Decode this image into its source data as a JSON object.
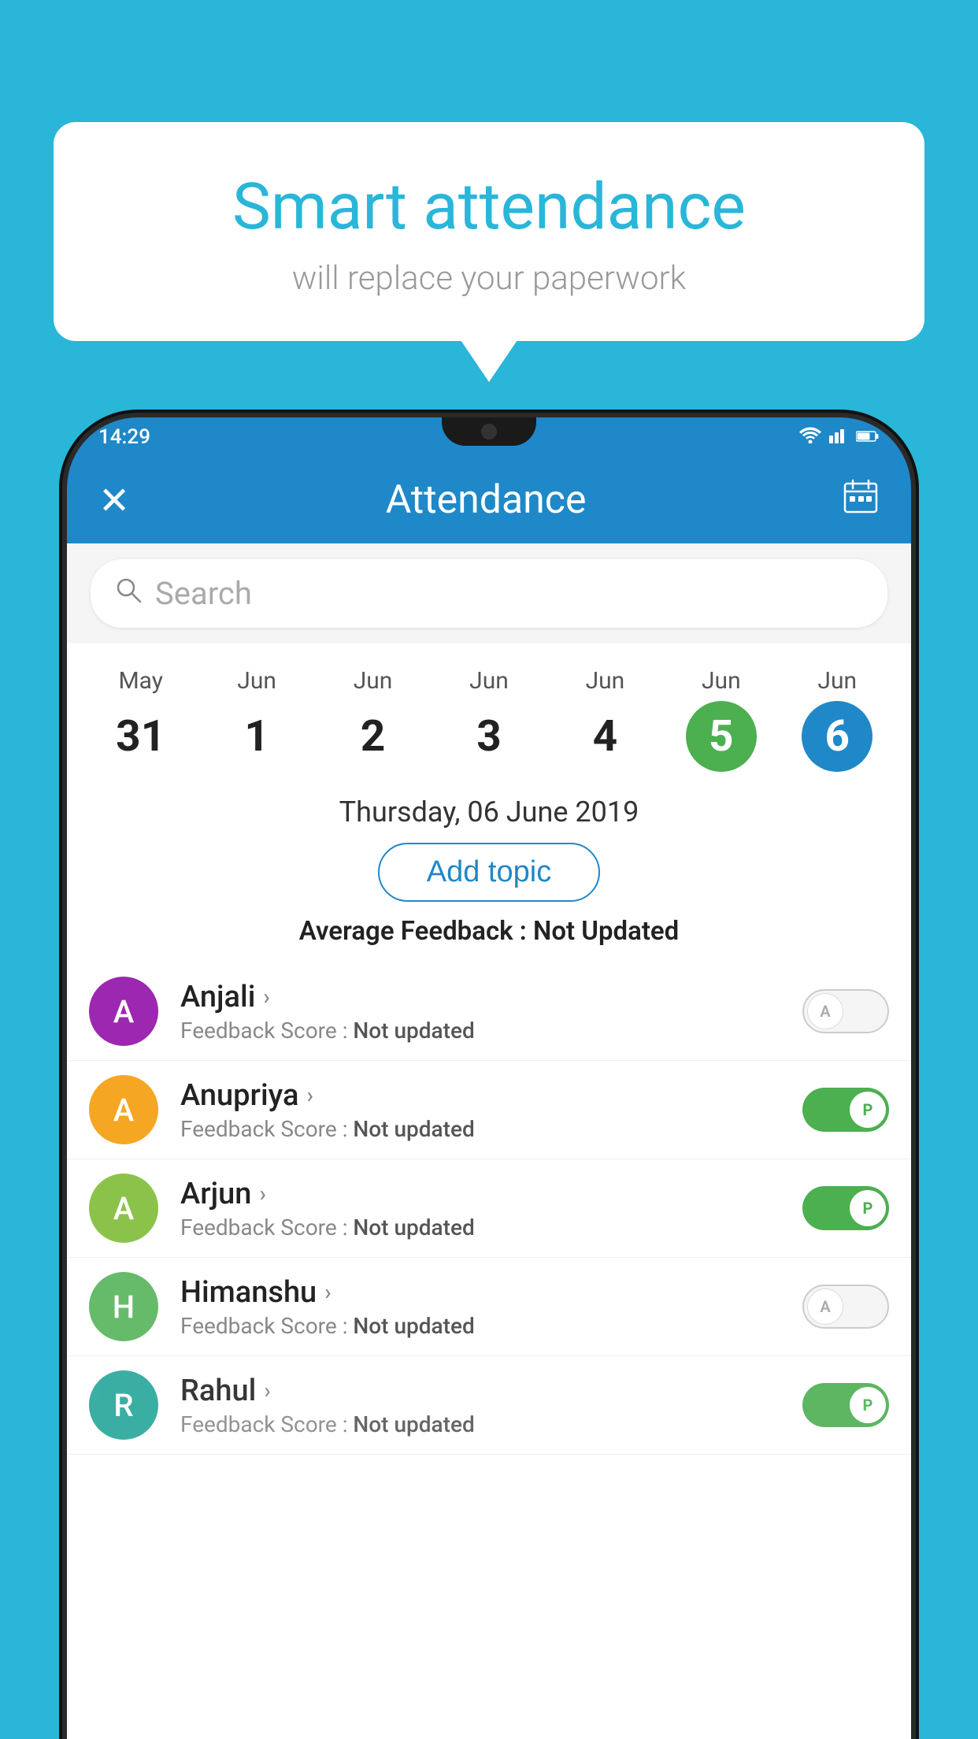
{
  "background_color": "#29b6d8",
  "bubble": {
    "title": "Smart attendance",
    "subtitle": "will replace your paperwork"
  },
  "phone": {
    "status_bar": {
      "time": "14:29",
      "icons": [
        "wifi",
        "signal",
        "battery"
      ]
    },
    "app_bar": {
      "title": "Attendance",
      "close_label": "×",
      "calendar_icon": "calendar"
    },
    "search": {
      "placeholder": "Search"
    },
    "dates": [
      {
        "month": "May",
        "day": "31",
        "active": ""
      },
      {
        "month": "Jun",
        "day": "1",
        "active": ""
      },
      {
        "month": "Jun",
        "day": "2",
        "active": ""
      },
      {
        "month": "Jun",
        "day": "3",
        "active": ""
      },
      {
        "month": "Jun",
        "day": "4",
        "active": ""
      },
      {
        "month": "Jun",
        "day": "5",
        "active": "green"
      },
      {
        "month": "Jun",
        "day": "6",
        "active": "blue"
      }
    ],
    "selected_date": "Thursday, 06 June 2019",
    "add_topic_label": "Add topic",
    "average_feedback_label": "Average Feedback :",
    "average_feedback_value": "Not Updated",
    "students": [
      {
        "name": "Anjali",
        "avatar_letter": "A",
        "avatar_color": "purple",
        "feedback_label": "Feedback Score :",
        "feedback_value": "Not updated",
        "toggle": "off",
        "toggle_letter": "A"
      },
      {
        "name": "Anupriya",
        "avatar_letter": "A",
        "avatar_color": "yellow",
        "feedback_label": "Feedback Score :",
        "feedback_value": "Not updated",
        "toggle": "on",
        "toggle_letter": "P"
      },
      {
        "name": "Arjun",
        "avatar_letter": "A",
        "avatar_color": "green",
        "feedback_label": "Feedback Score :",
        "feedback_value": "Not updated",
        "toggle": "on",
        "toggle_letter": "P"
      },
      {
        "name": "Himanshu",
        "avatar_letter": "H",
        "avatar_color": "light-green",
        "feedback_label": "Feedback Score :",
        "feedback_value": "Not updated",
        "toggle": "off",
        "toggle_letter": "A"
      },
      {
        "name": "Rahul",
        "avatar_letter": "R",
        "avatar_color": "teal",
        "feedback_label": "Feedback Score :",
        "feedback_value": "Not updated",
        "toggle": "on",
        "toggle_letter": "P"
      }
    ]
  }
}
